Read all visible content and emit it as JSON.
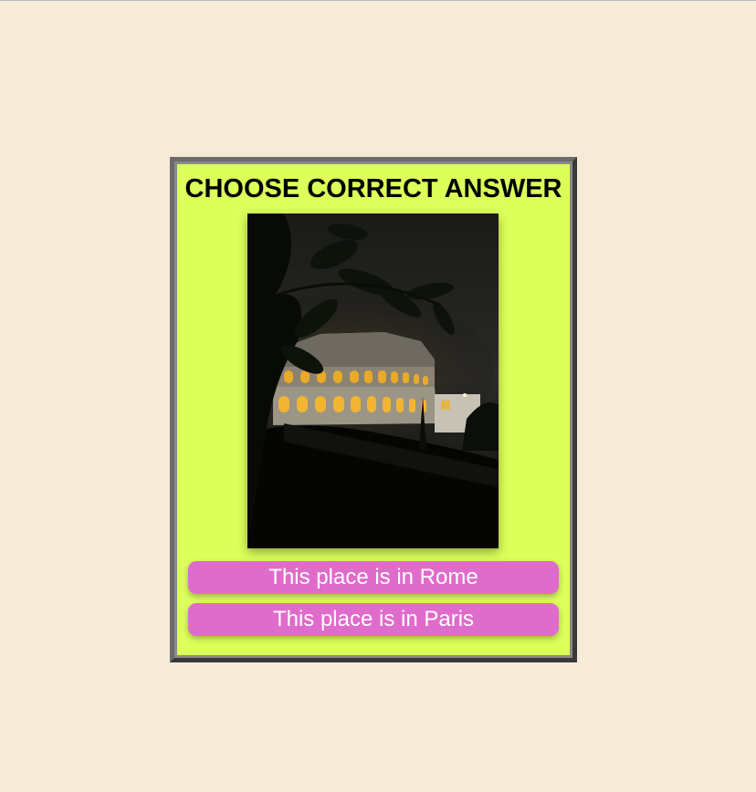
{
  "quiz": {
    "title": "CHOOSE CORRECT ANSWER",
    "image_subject": "colosseum-at-night",
    "answers": [
      {
        "label": "This place is in Rome"
      },
      {
        "label": "This place is in Paris"
      }
    ]
  },
  "colors": {
    "page_background": "#f6ead8",
    "card_background": "#dcff5a",
    "card_border": "#3a3a3a",
    "button_background": "#df6ccb",
    "button_text": "#ffffff",
    "title_text": "#000000"
  }
}
